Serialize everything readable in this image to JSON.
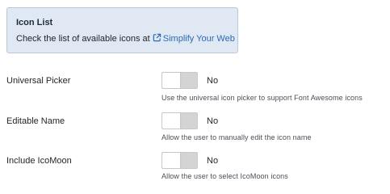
{
  "info_box": {
    "title": "Icon List",
    "text_prefix": "Check the list of available icons at ",
    "link_label": "Simplify Your Web",
    "link_icon": "external-link-icon"
  },
  "fields": [
    {
      "label": "Universal Picker",
      "toggle_state": "No",
      "toggle_on": false,
      "help": "Use the universal icon picker to support Font Awesome icons"
    },
    {
      "label": "Editable Name",
      "toggle_state": "No",
      "toggle_on": false,
      "help": "Allow the user to manually edit the icon name"
    },
    {
      "label": "Include IcoMoon",
      "toggle_state": "No",
      "toggle_on": false,
      "help": "Allow the user to select IcoMoon icons"
    }
  ],
  "colors": {
    "info_bg": "#dfe8f3",
    "link": "#2a6ab8",
    "toggle_off": "#d4d4d4"
  }
}
